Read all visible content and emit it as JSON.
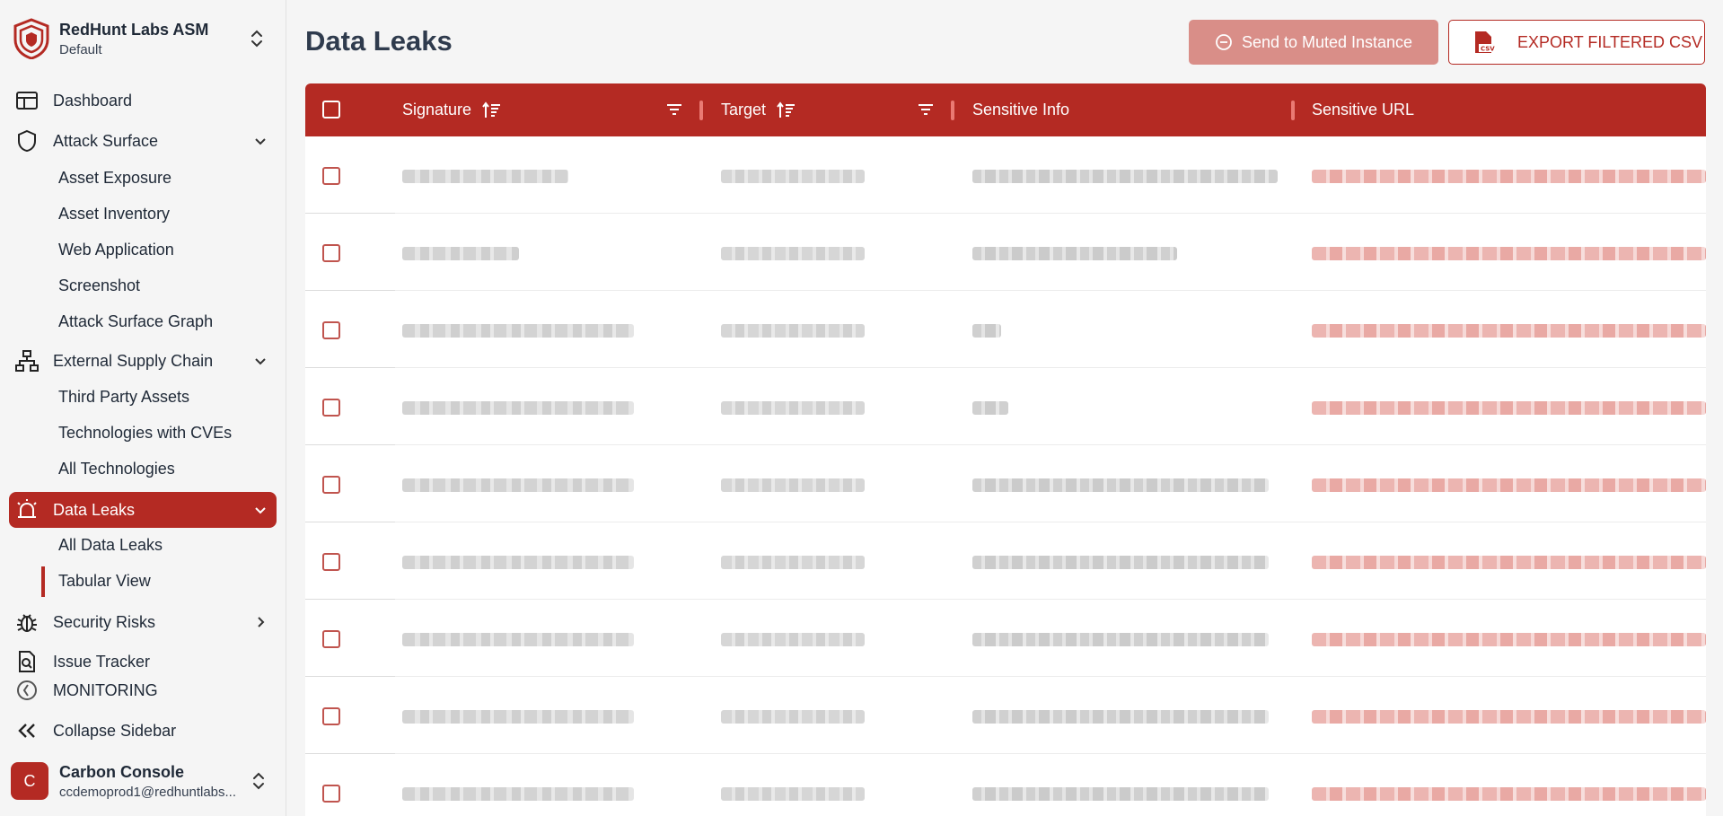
{
  "org": {
    "name": "RedHunt Labs ASM",
    "subtitle": "Default"
  },
  "nav": {
    "dashboard": "Dashboard",
    "attack_surface": "Attack Surface",
    "attack_surface_items": [
      "Asset Exposure",
      "Asset Inventory",
      "Web Application",
      "Screenshot",
      "Attack Surface Graph"
    ],
    "supply_chain": "External Supply Chain",
    "supply_chain_items": [
      "Third Party Assets",
      "Technologies with CVEs",
      "All Technologies"
    ],
    "data_leaks": "Data Leaks",
    "data_leaks_items": [
      "All Data Leaks",
      "Tabular View"
    ],
    "security_risks": "Security Risks",
    "issue_tracker": "Issue Tracker",
    "monitoring": "MONITORING",
    "collapse": "Collapse Sidebar"
  },
  "user": {
    "avatar_initial": "C",
    "name": "Carbon Console",
    "email": "ccdemoprod1@redhuntlabs..."
  },
  "page": {
    "title": "Data Leaks"
  },
  "actions": {
    "mute_label": "Send to Muted Instance",
    "export_label": "EXPORT FILTERED CSV"
  },
  "table": {
    "columns": [
      "Signature",
      "Target",
      "Sensitive Info",
      "Sensitive URL"
    ],
    "row_count": 9
  },
  "colors": {
    "accent": "#b42a23",
    "muted_button": "#d98e88"
  }
}
